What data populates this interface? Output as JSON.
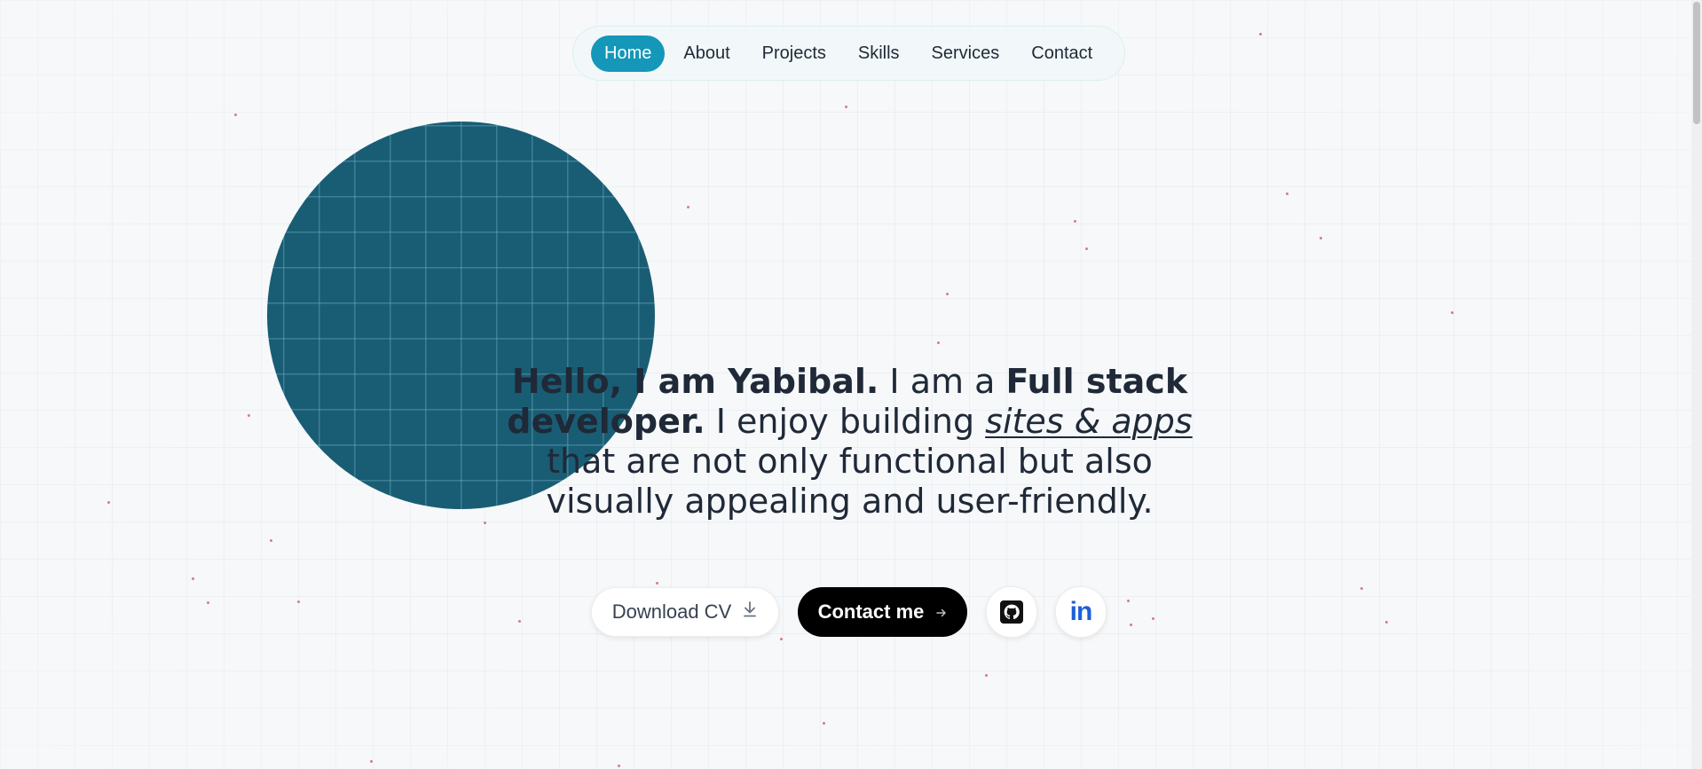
{
  "nav": {
    "items": [
      {
        "label": "Home",
        "active": true
      },
      {
        "label": "About",
        "active": false
      },
      {
        "label": "Projects",
        "active": false
      },
      {
        "label": "Skills",
        "active": false
      },
      {
        "label": "Services",
        "active": false
      },
      {
        "label": "Contact",
        "active": false
      }
    ]
  },
  "hero": {
    "intro_bold": "Hello, I am Yabibal.",
    "role_prefix": " I am a ",
    "role_bold": "Full stack developer.",
    "enjoy_prefix": " I enjoy building ",
    "enjoy_emphasis": "sites & apps",
    "enjoy_suffix": " that are not only functional but also visually appealing and user-friendly."
  },
  "actions": {
    "download_cv_label": "Download CV",
    "download_icon": "download-icon",
    "contact_label": "Contact me",
    "contact_icon": "arrow-right-icon",
    "github_icon": "github-icon",
    "linkedin_icon": "linkedin-icon",
    "linkedin_text": "in"
  },
  "colors": {
    "accent": "#1497b8",
    "circle": "#195d75",
    "dots": "#d97a84",
    "linkedin": "#1d5fd6"
  }
}
